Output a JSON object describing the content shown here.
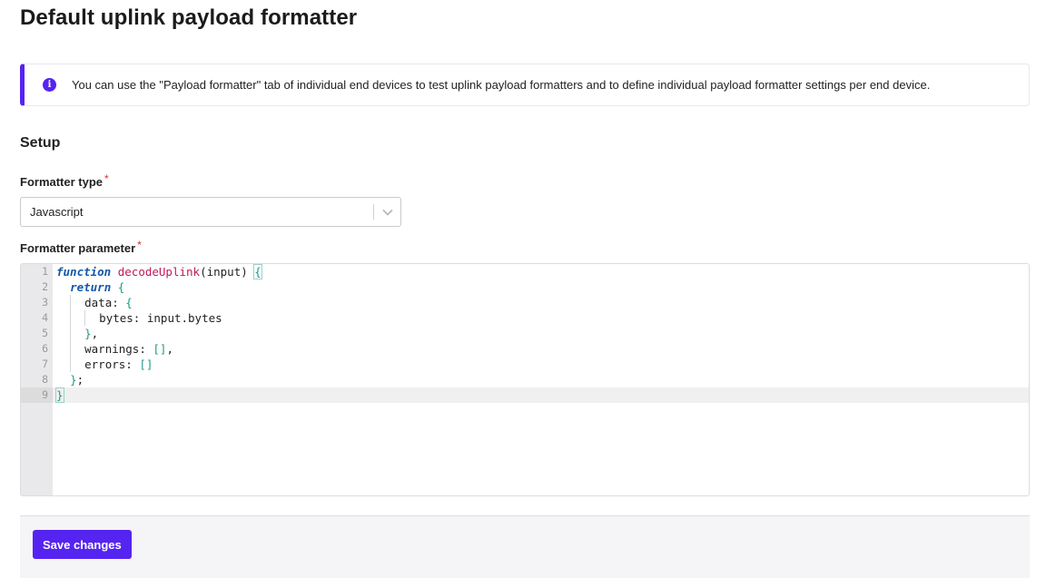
{
  "page": {
    "title": "Default uplink payload formatter"
  },
  "notice": {
    "icon": "info-icon",
    "text": "You can use the \"Payload formatter\" tab of individual end devices to test uplink payload formatters and to define individual payload formatter settings per end device."
  },
  "setup": {
    "title": "Setup",
    "formatter_type": {
      "label": "Formatter type",
      "required_mark": "*",
      "value": "Javascript"
    },
    "formatter_parameter": {
      "label": "Formatter parameter",
      "required_mark": "*",
      "line_numbers": [
        "1",
        "2",
        "3",
        "4",
        "5",
        "6",
        "7",
        "8",
        "9"
      ],
      "active_line": 9
    }
  },
  "footer": {
    "save_label": "Save changes"
  },
  "colors": {
    "accent": "#5524f1",
    "required": "#db2e2e",
    "keyword": "#1358a8",
    "function_name": "#c2185b",
    "bracket": "#1a9a87"
  }
}
